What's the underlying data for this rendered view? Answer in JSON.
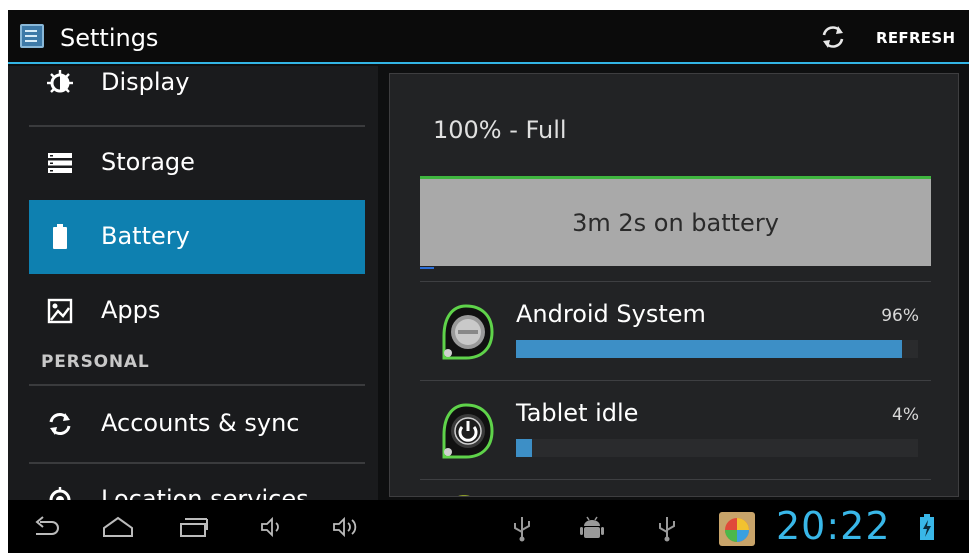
{
  "actionbar": {
    "title": "Settings",
    "refresh_label": "REFRESH"
  },
  "settings_list": {
    "items": [
      {
        "label": "Display",
        "icon": "display-icon"
      },
      {
        "label": "Storage",
        "icon": "storage-icon"
      },
      {
        "label": "Battery",
        "icon": "battery-icon",
        "selected": true
      },
      {
        "label": "Apps",
        "icon": "apps-icon"
      },
      {
        "label": "Accounts & sync",
        "icon": "sync-icon"
      },
      {
        "label": "Location services",
        "icon": "location-icon"
      }
    ],
    "section_personal": "PERSONAL"
  },
  "battery": {
    "charge_status": "100% - Full",
    "graph_text": "3m 2s on battery",
    "usage": [
      {
        "name": "Android System",
        "percent_label": "96%",
        "percent": 96
      },
      {
        "name": "Tablet idle",
        "percent_label": "4%",
        "percent": 4
      }
    ]
  },
  "statusbar": {
    "time": "20:22"
  },
  "colors": {
    "accent": "#33b5e5",
    "selected": "#0e80b0",
    "usage_bar": "#3d8fc6",
    "clock": "#39b7e8",
    "graph_line": "#3fb53f"
  }
}
